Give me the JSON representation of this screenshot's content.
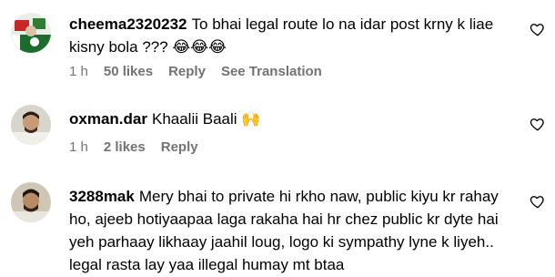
{
  "comments": [
    {
      "username": "cheema2320232",
      "text": "To bhai legal route lo na idar post krny k liae kisny bola ??? 😂😂😂",
      "time": "1 h",
      "likes": "50 likes",
      "reply": "Reply",
      "translation": "See Translation",
      "avatar": "flag-collage-avatar"
    },
    {
      "username": "oxman.dar",
      "text": "Khaalii Baali 🙌",
      "time": "1 h",
      "likes": "2 likes",
      "reply": "Reply",
      "avatar": "man-portrait-avatar"
    },
    {
      "username": "3288mak",
      "text": "Mery bhai to private hi rkho naw, public kiyu kr rahay ho, ajeeb hotiyaapaa laga rakaha hai hr chez public kr dyte hai yeh parhaay likhaay jaahil loug, logo ki sympathy lyne k liyeh.. legal rasta lay yaa illegal humay mt btaa",
      "avatar": "man-portrait-avatar"
    }
  ],
  "colors": {
    "text": "#000000",
    "meta": "#737373",
    "heart_stroke": "#000000"
  },
  "icons": {
    "like": "heart-outline-icon"
  }
}
